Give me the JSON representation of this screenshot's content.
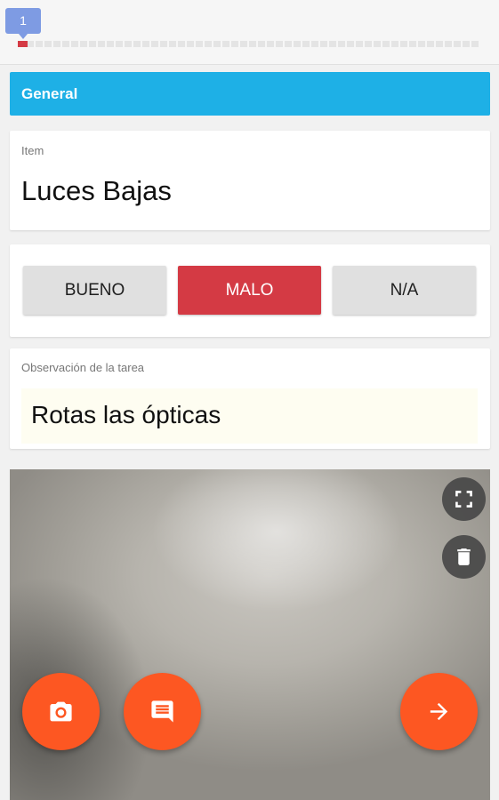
{
  "progress": {
    "current_step": "1",
    "fraction": 0.02
  },
  "section": {
    "title": "General"
  },
  "item": {
    "label": "Item",
    "value": "Luces Bajas"
  },
  "choices": {
    "good": "BUENO",
    "bad": "MALO",
    "na": "N/A",
    "selected": "MALO"
  },
  "observation": {
    "label": "Observación de la tarea",
    "value": "Rotas las ópticas"
  },
  "icons": {
    "fullscreen": "fullscreen-icon",
    "delete": "trash-icon",
    "camera": "camera-icon",
    "comment": "comment-icon",
    "next": "arrow-right-icon"
  },
  "colors": {
    "accent": "#1eb0e6",
    "selected": "#d43a44",
    "fab": "#fd5722",
    "step_badge": "#7e9be3"
  }
}
